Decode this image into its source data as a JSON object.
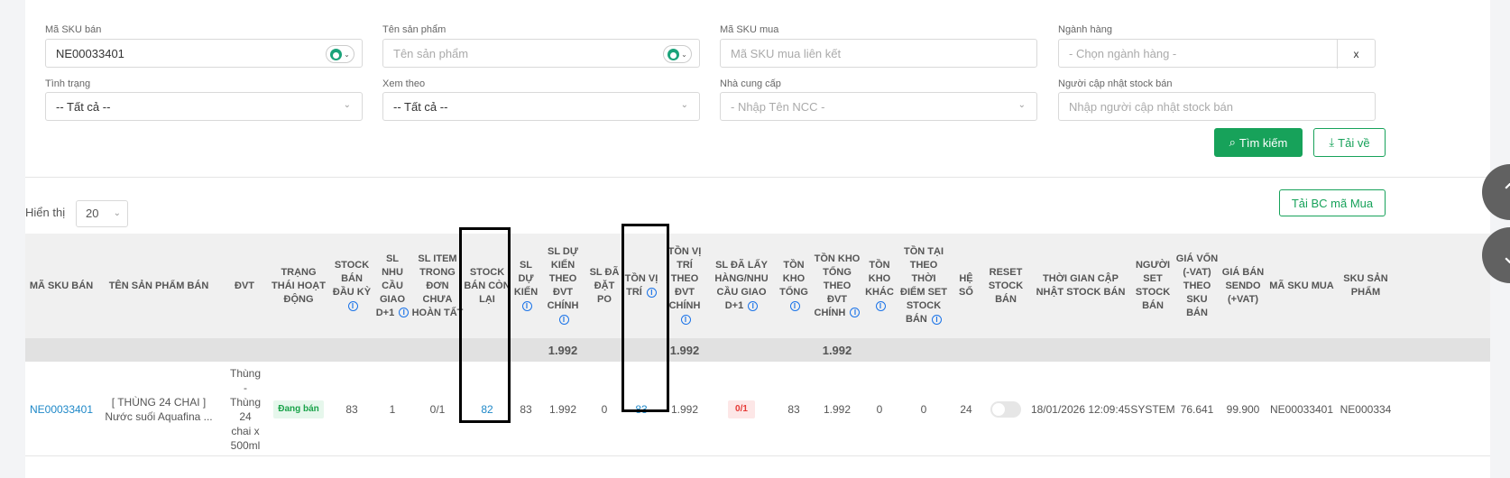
{
  "filters": {
    "sku_ban": {
      "label": "Mã SKU bán",
      "value": "NE00033401"
    },
    "ten_san_pham": {
      "label": "Tên sản phẩm",
      "placeholder": "Tên sản phẩm"
    },
    "sku_mua": {
      "label": "Mã SKU mua",
      "placeholder": "Mã SKU mua liên kết"
    },
    "nganh_hang": {
      "label": "Ngành hàng",
      "placeholder": "- Chọn ngành hàng -",
      "clear": "x"
    },
    "tinh_trang": {
      "label": "Tình trạng",
      "value": "-- Tất cả --"
    },
    "xem_theo": {
      "label": "Xem theo",
      "value": "-- Tất cả --"
    },
    "nha_cung_cap": {
      "label": "Nhà cung cấp",
      "placeholder": "- Nhập Tên NCC -"
    },
    "nguoi_cap_nhat": {
      "label": "Người cập nhật stock bán",
      "placeholder": "Nhập người cập nhật stock bán"
    }
  },
  "buttons": {
    "search": "Tìm kiếm",
    "download": "Tải về",
    "report": "Tải BC mã Mua"
  },
  "paging": {
    "label": "Hiển thị",
    "value": "20"
  },
  "columns": [
    "Mã SKU bán",
    "Tên sản phẩm bán",
    "ĐVT",
    "Trạng thái hoạt động",
    "Stock bán đầu kỳ",
    "SL nhu cầu giao D+1",
    "SL item trong đơn chưa hoàn tất",
    "Stock bán còn lại",
    "SL dự kiến",
    "SL dự kiến theo ĐVT chính",
    "SL đã đặt PO",
    "Tồn vị trí",
    "Tồn vị trí theo ĐVT chính",
    "SL đã lấy hàng/nhu cầu giao D+1",
    "Tồn kho tổng",
    "Tồn kho tổng theo ĐVT chính",
    "Tồn kho khác",
    "Tồn tại theo thời điểm set stock bán",
    "Hệ số",
    "Reset stock bán",
    "Thời gian cập nhật stock bán",
    "Người set stock bán",
    "Giá vốn (-VAT) theo SKU bán",
    "Giá bán Sendo (+VAT)",
    "Mã SKU mua",
    "SKU sản phẩm"
  ],
  "summary": {
    "sl_du_kien_dvt": "1.992",
    "ton_vi_tri_dvt": "1.992",
    "ton_kho_tong_dvt": "1.992"
  },
  "row": {
    "sku": "NE00033401",
    "name": "[ THÙNG 24 CHAI ] Nước suối Aquafina ...",
    "dvt": "Thùng - Thùng 24 chai x 500ml",
    "status": "Đang bán",
    "stock_dau_ky": "83",
    "nhu_cau": "1",
    "item_chua_hoan_tat": "0/1",
    "stock_con_lai": "82",
    "sl_du_kien": "83",
    "sl_du_kien_dvt": "1.992",
    "da_dat_po": "0",
    "ton_vi_tri": "83",
    "ton_vi_tri_dvt": "1.992",
    "da_lay_hang": "0/1",
    "ton_kho_tong": "83",
    "ton_kho_tong_dvt": "1.992",
    "ton_kho_khac": "0",
    "ton_tai_thoi_diem": "0",
    "he_so": "24",
    "thoi_gian": "18/01/2026 12:09:45",
    "nguoi_set": "SYSTEM",
    "gia_von": "76.641",
    "gia_ban": "99.900",
    "sku_mua": "NE00033401",
    "sku_san_pham": "NE000334"
  },
  "colors": {
    "accent": "#17a25a",
    "link": "#1e88c8"
  },
  "icons": [
    "search-icon",
    "download-icon",
    "info-icon",
    "chevron-down-icon",
    "chevron-up-icon"
  ]
}
